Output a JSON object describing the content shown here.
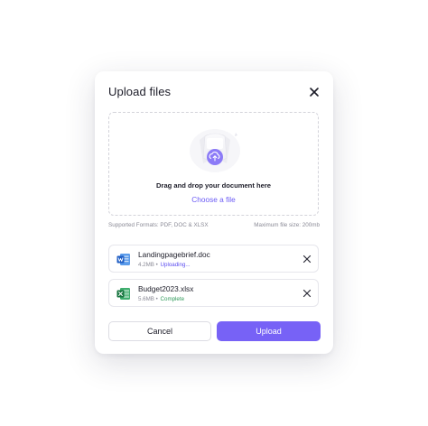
{
  "dialog": {
    "title": "Upload files"
  },
  "dropzone": {
    "title": "Drag and drop your document here",
    "link": "Choose a file"
  },
  "meta": {
    "formats": "Supported Formats: PDF, DOC & XLSX",
    "max_size": "Maximum file size: 200mb"
  },
  "files": [
    {
      "name": "Landingpagebrief.doc",
      "size": "4.2MB",
      "separator": "•",
      "status": "Uploading...",
      "icon": "word-doc-icon",
      "status_color": "#5b4cf0"
    },
    {
      "name": "Budget2023.xlsx",
      "size": "5.6MB",
      "separator": "•",
      "status": "Complete",
      "icon": "excel-sheet-icon",
      "status_color": "#2f9a5a"
    }
  ],
  "actions": {
    "cancel": "Cancel",
    "upload": "Upload"
  },
  "colors": {
    "accent": "#7762f6",
    "link": "#6b5bf5"
  }
}
